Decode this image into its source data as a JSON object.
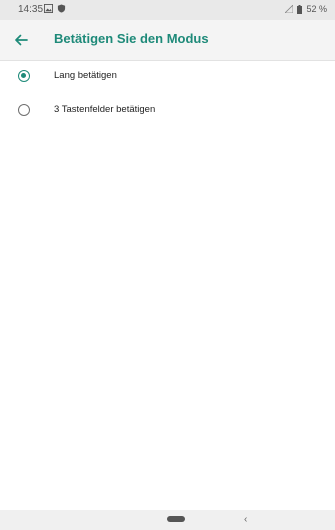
{
  "status_bar": {
    "time": "14:35",
    "battery": "52 %",
    "icons": [
      "image-icon",
      "shield-icon",
      "signal-icon",
      "battery-icon"
    ]
  },
  "app_bar": {
    "title": "Betätigen Sie den Modus",
    "back_icon": "arrow-left-icon"
  },
  "options": [
    {
      "label": "Lang betätigen",
      "selected": true
    },
    {
      "label": "3 Tastenfelder betätigen",
      "selected": false
    }
  ],
  "nav_bar": {
    "back_glyph": "‹"
  },
  "colors": {
    "accent": "#1e8a79",
    "status_bar": "#e9e9e9"
  }
}
